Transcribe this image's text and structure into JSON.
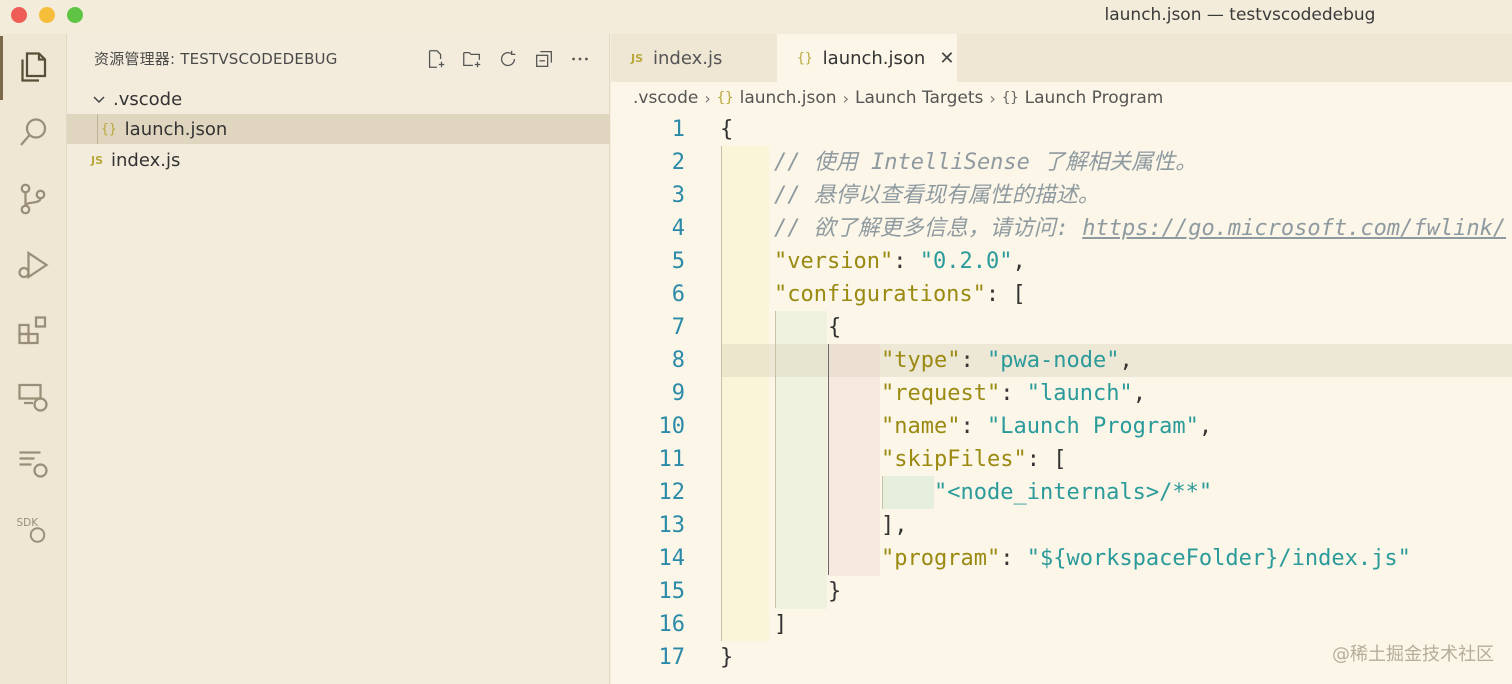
{
  "window": {
    "title": "launch.json — testvscodedebug"
  },
  "activity_bar": {
    "items": [
      "files-icon",
      "search-icon",
      "source-control-icon",
      "run-debug-icon",
      "extensions-icon",
      "remote-explorer-icon",
      "api-debug-icon",
      "sdk-debug-icon"
    ]
  },
  "sidebar": {
    "header": "资源管理器: TESTVSCODEDEBUG",
    "actions": [
      "new-file-icon",
      "new-folder-icon",
      "refresh-icon",
      "collapse-all-icon",
      "more-icon"
    ],
    "tree": [
      {
        "label": ".vscode",
        "type": "folder",
        "expanded": true
      },
      {
        "label": "launch.json",
        "type": "json",
        "selected": true
      },
      {
        "label": "index.js",
        "type": "js"
      }
    ]
  },
  "editor": {
    "tabs": [
      {
        "label": "index.js",
        "type": "js",
        "active": false
      },
      {
        "label": "launch.json",
        "type": "json",
        "active": true
      }
    ],
    "breadcrumb": {
      "folder": ".vscode",
      "file": "launch.json",
      "section": "Launch Targets",
      "item": "Launch Program"
    },
    "lines": {
      "l1": "{",
      "l2": "// 使用 IntelliSense 了解相关属性。",
      "l3": "// 悬停以查看现有属性的描述。",
      "l4_prefix": "// 欲了解更多信息，请访问: ",
      "l4_link": "https://go.microsoft.com/fwlink/",
      "l5_key": "\"version\"",
      "l5_val": "\"0.2.0\"",
      "l6_key": "\"configurations\"",
      "l7": "{",
      "l8_key": "\"type\"",
      "l8_val": "\"pwa-node\"",
      "l9_key": "\"request\"",
      "l9_val": "\"launch\"",
      "l10_key": "\"name\"",
      "l10_val": "\"Launch Program\"",
      "l11_key": "\"skipFiles\"",
      "l12_val": "\"<node_internals>/**\"",
      "l13": "],",
      "l14_key": "\"program\"",
      "l14_val": "\"${workspaceFolder}/index.js\"",
      "l15": "}",
      "l16": "]",
      "l17": "}"
    },
    "line_numbers": [
      "1",
      "2",
      "3",
      "4",
      "5",
      "6",
      "7",
      "8",
      "9",
      "10",
      "11",
      "12",
      "13",
      "14",
      "15",
      "16",
      "17"
    ]
  },
  "watermark": "@稀土掘金技术社区"
}
